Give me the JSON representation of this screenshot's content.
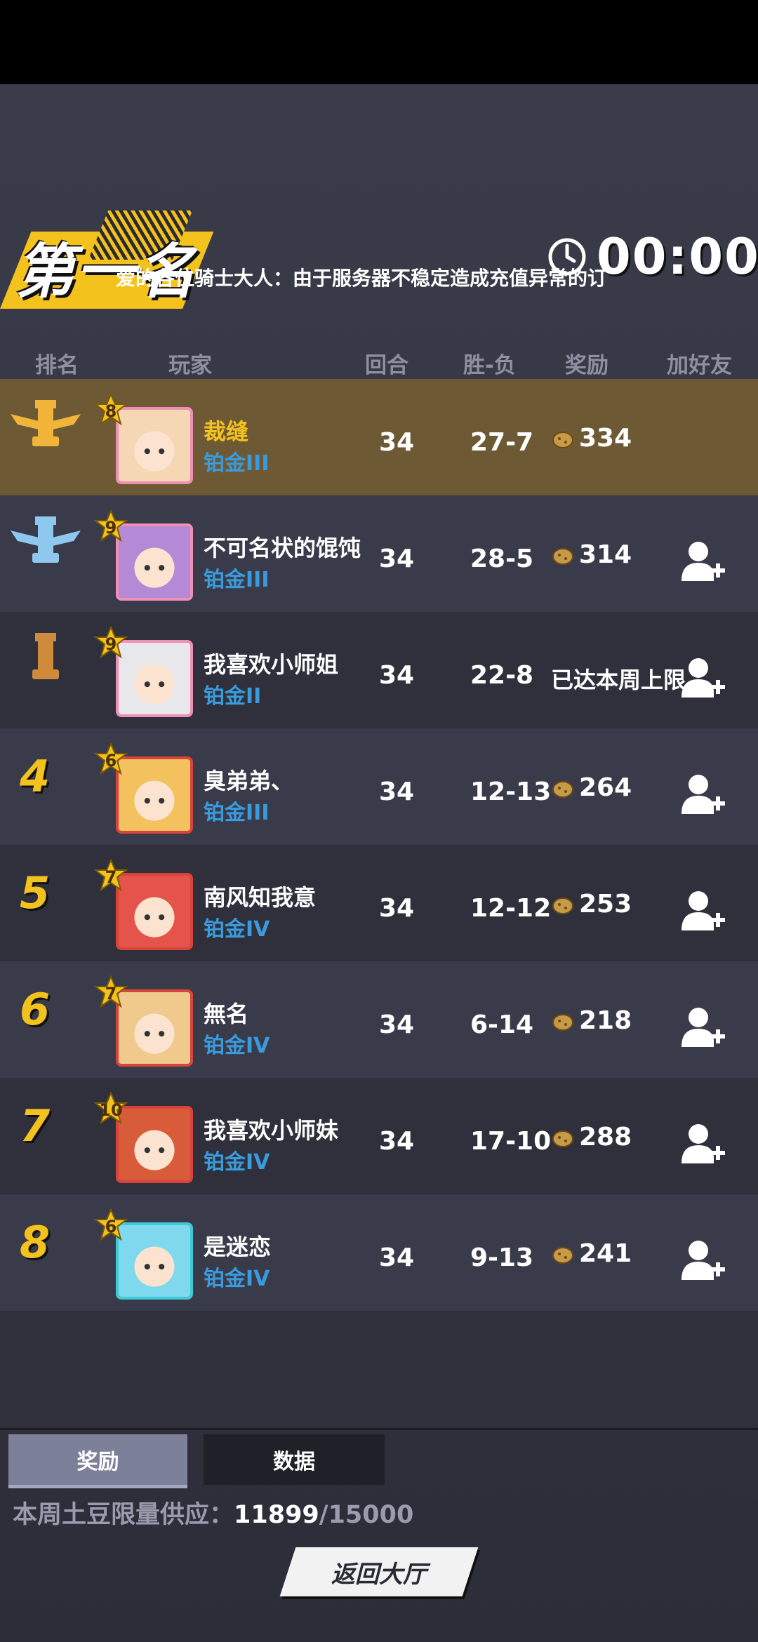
{
  "header": {
    "rank_title": "第一名",
    "notice": "爱的各位骑士大人：由于服务器不稳定造成充值异常的订",
    "timer": "00:00"
  },
  "table": {
    "columns": [
      "排名",
      "玩家",
      "回合",
      "胜-负",
      "奖励",
      "加好友"
    ],
    "rows": [
      {
        "rank": "1",
        "rank_icon": "gold-rook-wings-icon",
        "level": "8",
        "name": "裁缝",
        "tier": "铂金III",
        "rounds": "34",
        "wl": "27-7",
        "reward": "334",
        "add_friend": false
      },
      {
        "rank": "2",
        "rank_icon": "silver-rook-wings-icon",
        "level": "9",
        "name": "不可名状的馄饨",
        "tier": "铂金III",
        "rounds": "34",
        "wl": "28-5",
        "reward": "314",
        "add_friend": true
      },
      {
        "rank": "3",
        "rank_icon": "bronze-rook-icon",
        "level": "9",
        "name": "我喜欢小师姐",
        "tier": "铂金II",
        "rounds": "34",
        "wl": "22-8",
        "reward": "已达本周上限",
        "add_friend": true
      },
      {
        "rank": "4",
        "level": "6",
        "name": "臭弟弟、",
        "tier": "铂金III",
        "rounds": "34",
        "wl": "12-13",
        "reward": "264",
        "add_friend": true
      },
      {
        "rank": "5",
        "level": "7",
        "name": "南风知我意",
        "tier": "铂金IV",
        "rounds": "34",
        "wl": "12-12",
        "reward": "253",
        "add_friend": true
      },
      {
        "rank": "6",
        "level": "7",
        "name": "無名",
        "tier": "铂金IV",
        "rounds": "34",
        "wl": "6-14",
        "reward": "218",
        "add_friend": true
      },
      {
        "rank": "7",
        "level": "10",
        "name": "我喜欢小师妹",
        "tier": "铂金IV",
        "rounds": "34",
        "wl": "17-10",
        "reward": "288",
        "add_friend": true
      },
      {
        "rank": "8",
        "level": "6",
        "name": "是迷恋",
        "tier": "铂金IV",
        "rounds": "34",
        "wl": "9-13",
        "reward": "241",
        "add_friend": true
      }
    ]
  },
  "tabs": {
    "reward": "奖励",
    "data": "数据"
  },
  "supply": {
    "label": "本周土豆限量供应：",
    "current": "11899",
    "max": "/15000"
  },
  "back_button": "返回大厅",
  "colors": {
    "accent": "#f4c21c",
    "tier_blue": "#3a9bdc",
    "first_row": "#6d5a35"
  }
}
